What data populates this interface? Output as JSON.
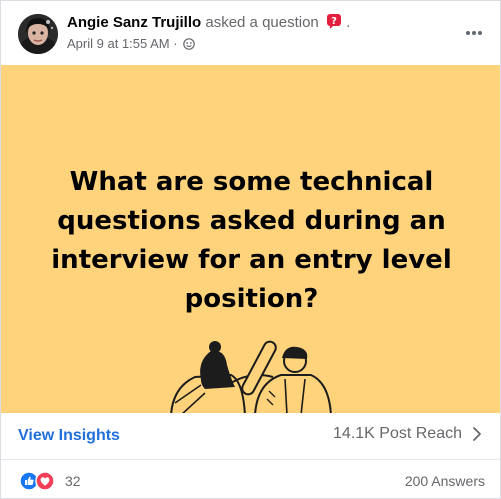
{
  "post": {
    "author_name": "Angie Sanz Trujillo",
    "action_text": "asked a question",
    "trailing_punct": ".",
    "timestamp": "April 9 at 1:55 AM",
    "meta_separator": "·",
    "privacy_icon": "friends-icon"
  },
  "question": {
    "text": "What are some technical questions asked during an interview for an entry level position?",
    "background_color": "#fed37b"
  },
  "insights": {
    "view_label": "View Insights",
    "reach_label": "14.1K Post Reach"
  },
  "reactions": {
    "types": [
      "like",
      "love"
    ],
    "count": "32",
    "answers_label": "200 Answers"
  },
  "colors": {
    "link_blue": "#216fdb",
    "question_badge_red": "#e41e3f",
    "like_blue": "#1877f2",
    "love_red": "#f33e58",
    "secondary_text": "#65676b"
  }
}
